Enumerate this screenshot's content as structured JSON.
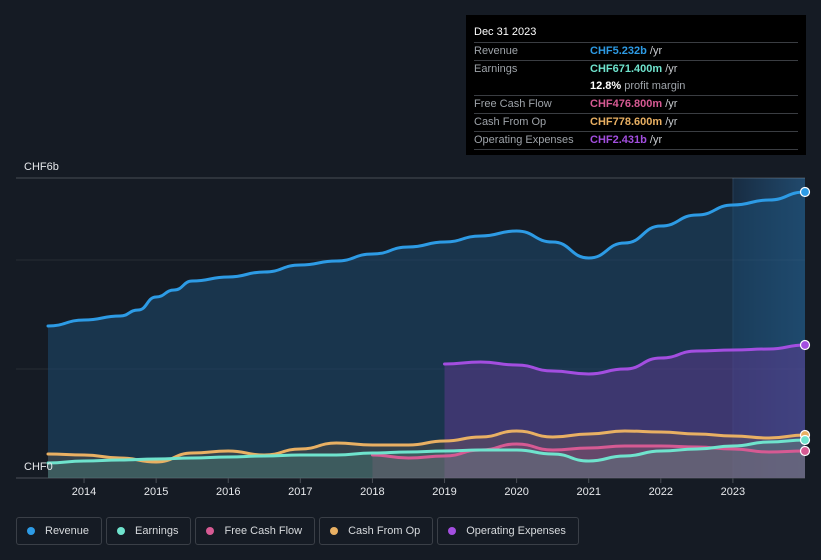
{
  "tooltip": {
    "date": "Dec 31 2023",
    "rows": [
      {
        "label": "Revenue",
        "value": "CHF5.232b",
        "unit": " /yr",
        "color": "#2d9be5"
      },
      {
        "label": "Earnings",
        "value": "CHF671.400m",
        "unit": " /yr",
        "color": "#6fe3cd"
      },
      {
        "label": "",
        "value": "12.8%",
        "unit": " profit margin",
        "color": "#ffffff"
      },
      {
        "label": "Free Cash Flow",
        "value": "CHF476.800m",
        "unit": " /yr",
        "color": "#d65a93"
      },
      {
        "label": "Cash From Op",
        "value": "CHF778.600m",
        "unit": " /yr",
        "color": "#e9b063"
      },
      {
        "label": "Operating Expenses",
        "value": "CHF2.431b",
        "unit": " /yr",
        "color": "#a34ee0"
      }
    ]
  },
  "legend": [
    {
      "label": "Revenue",
      "color": "#2d9be5"
    },
    {
      "label": "Earnings",
      "color": "#6fe3cd"
    },
    {
      "label": "Free Cash Flow",
      "color": "#d65a93"
    },
    {
      "label": "Cash From Op",
      "color": "#e9b063"
    },
    {
      "label": "Operating Expenses",
      "color": "#a34ee0"
    }
  ],
  "chart_data": {
    "type": "area",
    "title": "",
    "xlabel": "",
    "ylabel": "",
    "y_top_label": "CHF6b",
    "y_bottom_label": "CHF0",
    "ylim": [
      0,
      6
    ],
    "xlim": [
      2013.5,
      2024.0
    ],
    "x_ticks": [
      "2014",
      "2015",
      "2016",
      "2017",
      "2018",
      "2019",
      "2020",
      "2021",
      "2022",
      "2023"
    ],
    "x_tick_values": [
      2014,
      2015,
      2016,
      2017,
      2018,
      2019,
      2020,
      2021,
      2022,
      2023
    ],
    "highlight_region_start": 2023.0,
    "grid": true,
    "unit": "CHF billions",
    "series": [
      {
        "name": "Revenue",
        "color": "#2d9be5",
        "x": [
          2013.5,
          2014.0,
          2014.5,
          2014.75,
          2015.0,
          2015.25,
          2015.5,
          2016.0,
          2016.5,
          2017.0,
          2017.5,
          2018.0,
          2018.5,
          2019.0,
          2019.5,
          2020.0,
          2020.5,
          2021.0,
          2021.5,
          2022.0,
          2022.5,
          2023.0,
          2023.5,
          2024.0
        ],
        "values": [
          3.04,
          3.16,
          3.24,
          3.36,
          3.62,
          3.76,
          3.94,
          4.02,
          4.12,
          4.26,
          4.34,
          4.48,
          4.62,
          4.72,
          4.84,
          4.94,
          4.72,
          4.4,
          4.7,
          5.04,
          5.26,
          5.46,
          5.56,
          5.72
        ]
      },
      {
        "name": "Operating Expenses",
        "color": "#a34ee0",
        "x": [
          2019.0,
          2019.5,
          2020.0,
          2020.5,
          2021.0,
          2021.5,
          2022.0,
          2022.5,
          2023.0,
          2023.5,
          2024.0
        ],
        "values": [
          2.28,
          2.32,
          2.26,
          2.14,
          2.08,
          2.18,
          2.4,
          2.54,
          2.56,
          2.58,
          2.66
        ]
      },
      {
        "name": "Cash From Op",
        "color": "#e9b063",
        "x": [
          2013.5,
          2014.0,
          2014.5,
          2015.0,
          2015.5,
          2016.0,
          2016.5,
          2017.0,
          2017.5,
          2018.0,
          2018.5,
          2019.0,
          2019.5,
          2020.0,
          2020.5,
          2021.0,
          2021.5,
          2022.0,
          2022.5,
          2023.0,
          2023.5,
          2024.0
        ],
        "values": [
          0.48,
          0.46,
          0.4,
          0.32,
          0.5,
          0.54,
          0.46,
          0.58,
          0.7,
          0.66,
          0.66,
          0.74,
          0.82,
          0.94,
          0.82,
          0.88,
          0.94,
          0.92,
          0.88,
          0.84,
          0.8,
          0.86
        ]
      },
      {
        "name": "Free Cash Flow",
        "color": "#d65a93",
        "x": [
          2018.0,
          2018.5,
          2019.0,
          2019.5,
          2020.0,
          2020.5,
          2021.0,
          2021.5,
          2022.0,
          2022.5,
          2023.0,
          2023.5,
          2024.0
        ],
        "values": [
          0.46,
          0.4,
          0.44,
          0.56,
          0.68,
          0.56,
          0.6,
          0.64,
          0.64,
          0.62,
          0.58,
          0.52,
          0.54
        ]
      },
      {
        "name": "Earnings",
        "color": "#6fe3cd",
        "x": [
          2013.5,
          2014.0,
          2014.5,
          2015.0,
          2015.5,
          2016.0,
          2016.5,
          2017.0,
          2017.5,
          2018.0,
          2018.5,
          2019.0,
          2019.5,
          2020.0,
          2020.5,
          2021.0,
          2021.5,
          2022.0,
          2022.5,
          2023.0,
          2023.5,
          2024.0
        ],
        "values": [
          0.3,
          0.34,
          0.36,
          0.38,
          0.4,
          0.42,
          0.44,
          0.46,
          0.46,
          0.5,
          0.52,
          0.54,
          0.56,
          0.56,
          0.48,
          0.34,
          0.44,
          0.54,
          0.58,
          0.64,
          0.72,
          0.76
        ]
      }
    ]
  }
}
